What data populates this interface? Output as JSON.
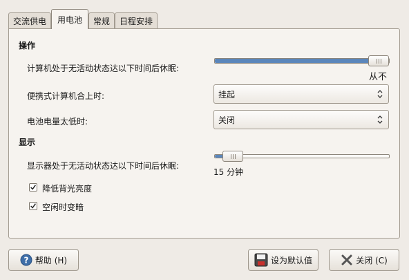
{
  "tabs": [
    {
      "label": "交流供电",
      "active": false
    },
    {
      "label": "用电池",
      "active": true
    },
    {
      "label": "常规",
      "active": false
    },
    {
      "label": "日程安排",
      "active": false
    }
  ],
  "actions": {
    "heading": "操作",
    "sleep_label": "计算机处于无活动状态达以下时间后休眠:",
    "sleep_value_text": "从不",
    "sleep_fraction": 1.0,
    "lid_label": "便携式计算机合上时:",
    "lid_value": "挂起",
    "battery_low_label": "电池电量太低时:",
    "battery_low_value": "关闭"
  },
  "display": {
    "heading": "显示",
    "sleep_label": "显示器处于无活动状态达以下时间后休眠:",
    "sleep_value_text": "15 分钟",
    "sleep_fraction": 0.05,
    "dim_backlight_label": "降低背光亮度",
    "dim_backlight_checked": true,
    "dim_idle_label": "空闲时变暗",
    "dim_idle_checked": true
  },
  "buttons": {
    "help": "帮助 (H)",
    "make_default": "设为默认值",
    "close": "关闭 (C)"
  },
  "colors": {
    "slider_fill": "#5b86bb",
    "help_icon": "#3e6ea8"
  }
}
